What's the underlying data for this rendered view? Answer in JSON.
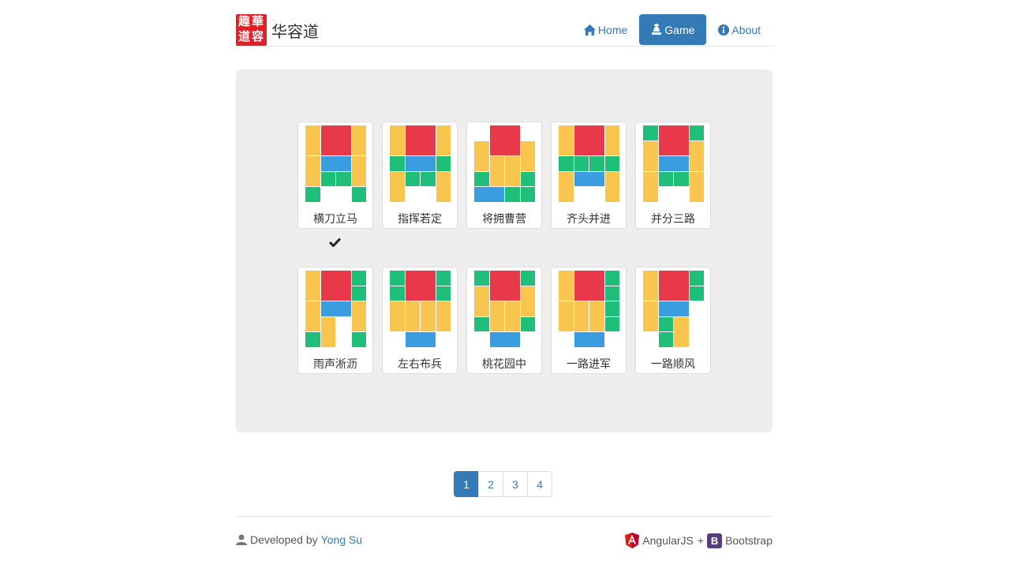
{
  "header": {
    "title": "华容道",
    "nav": [
      {
        "label": "Home",
        "icon": "home-icon",
        "active": false
      },
      {
        "label": "Game",
        "icon": "game-piece-icon",
        "active": true
      },
      {
        "label": "About",
        "icon": "info-icon",
        "active": false
      }
    ]
  },
  "colors": {
    "red": "#e8394a",
    "yellow": "#f8c64e",
    "green": "#1fbf7a",
    "blue": "#3a9de0",
    "accent": "#337ab7"
  },
  "levels": [
    {
      "label": "横刀立马",
      "solved": true,
      "pieces": [
        [
          0,
          0,
          1,
          2,
          "y"
        ],
        [
          1,
          0,
          2,
          2,
          "r"
        ],
        [
          3,
          0,
          1,
          2,
          "y"
        ],
        [
          0,
          2,
          1,
          2,
          "y"
        ],
        [
          1,
          2,
          2,
          1,
          "b"
        ],
        [
          3,
          2,
          1,
          2,
          "y"
        ],
        [
          1,
          3,
          1,
          1,
          "g"
        ],
        [
          2,
          3,
          1,
          1,
          "g"
        ],
        [
          0,
          4,
          1,
          1,
          "g"
        ],
        [
          3,
          4,
          1,
          1,
          "g"
        ]
      ]
    },
    {
      "label": "指挥若定",
      "solved": false,
      "pieces": [
        [
          0,
          0,
          1,
          2,
          "y"
        ],
        [
          1,
          0,
          2,
          2,
          "r"
        ],
        [
          3,
          0,
          1,
          2,
          "y"
        ],
        [
          0,
          2,
          1,
          1,
          "g"
        ],
        [
          1,
          2,
          2,
          1,
          "b"
        ],
        [
          3,
          2,
          1,
          1,
          "g"
        ],
        [
          0,
          3,
          1,
          2,
          "y"
        ],
        [
          1,
          3,
          1,
          1,
          "g"
        ],
        [
          2,
          3,
          1,
          1,
          "g"
        ],
        [
          3,
          3,
          1,
          2,
          "y"
        ]
      ]
    },
    {
      "label": "将拥曹营",
      "solved": false,
      "pieces": [
        [
          1,
          0,
          2,
          2,
          "r"
        ],
        [
          0,
          1,
          1,
          2,
          "y"
        ],
        [
          3,
          1,
          1,
          2,
          "y"
        ],
        [
          1,
          2,
          1,
          2,
          "y"
        ],
        [
          2,
          2,
          1,
          2,
          "y"
        ],
        [
          0,
          3,
          1,
          1,
          "g"
        ],
        [
          3,
          3,
          1,
          1,
          "g"
        ],
        [
          0,
          4,
          2,
          1,
          "b"
        ],
        [
          2,
          4,
          1,
          1,
          "g"
        ],
        [
          3,
          4,
          1,
          1,
          "g"
        ]
      ]
    },
    {
      "label": "齐头并进",
      "solved": false,
      "pieces": [
        [
          0,
          0,
          1,
          2,
          "y"
        ],
        [
          1,
          0,
          2,
          2,
          "r"
        ],
        [
          3,
          0,
          1,
          2,
          "y"
        ],
        [
          0,
          2,
          1,
          1,
          "g"
        ],
        [
          1,
          2,
          1,
          1,
          "g"
        ],
        [
          2,
          2,
          1,
          1,
          "g"
        ],
        [
          3,
          2,
          1,
          1,
          "g"
        ],
        [
          0,
          3,
          1,
          2,
          "y"
        ],
        [
          1,
          3,
          2,
          1,
          "b"
        ],
        [
          3,
          3,
          1,
          2,
          "y"
        ]
      ]
    },
    {
      "label": "并分三路",
      "solved": false,
      "pieces": [
        [
          0,
          0,
          1,
          1,
          "g"
        ],
        [
          1,
          0,
          2,
          2,
          "r"
        ],
        [
          3,
          0,
          1,
          1,
          "g"
        ],
        [
          0,
          1,
          1,
          2,
          "y"
        ],
        [
          3,
          1,
          1,
          2,
          "y"
        ],
        [
          1,
          2,
          2,
          1,
          "b"
        ],
        [
          0,
          3,
          1,
          2,
          "y"
        ],
        [
          1,
          3,
          1,
          1,
          "g"
        ],
        [
          2,
          3,
          1,
          1,
          "g"
        ],
        [
          3,
          3,
          1,
          2,
          "y"
        ]
      ]
    },
    {
      "label": "雨声淅沥",
      "solved": false,
      "pieces": [
        [
          0,
          0,
          1,
          2,
          "y"
        ],
        [
          1,
          0,
          2,
          2,
          "r"
        ],
        [
          3,
          0,
          1,
          1,
          "g"
        ],
        [
          3,
          1,
          1,
          1,
          "g"
        ],
        [
          0,
          2,
          1,
          2,
          "y"
        ],
        [
          1,
          2,
          2,
          1,
          "b"
        ],
        [
          3,
          2,
          1,
          2,
          "y"
        ],
        [
          1,
          3,
          1,
          2,
          "y"
        ],
        [
          0,
          4,
          1,
          1,
          "g"
        ],
        [
          3,
          4,
          1,
          1,
          "g"
        ]
      ]
    },
    {
      "label": "左右布兵",
      "solved": false,
      "pieces": [
        [
          0,
          0,
          1,
          1,
          "g"
        ],
        [
          1,
          0,
          2,
          2,
          "r"
        ],
        [
          3,
          0,
          1,
          1,
          "g"
        ],
        [
          0,
          1,
          1,
          1,
          "g"
        ],
        [
          3,
          1,
          1,
          1,
          "g"
        ],
        [
          0,
          2,
          1,
          2,
          "y"
        ],
        [
          1,
          2,
          1,
          2,
          "y"
        ],
        [
          2,
          2,
          1,
          2,
          "y"
        ],
        [
          3,
          2,
          1,
          2,
          "y"
        ],
        [
          1,
          4,
          2,
          1,
          "b"
        ]
      ]
    },
    {
      "label": "桃花园中",
      "solved": false,
      "pieces": [
        [
          0,
          0,
          1,
          1,
          "g"
        ],
        [
          1,
          0,
          2,
          2,
          "r"
        ],
        [
          3,
          0,
          1,
          1,
          "g"
        ],
        [
          0,
          1,
          1,
          2,
          "y"
        ],
        [
          3,
          1,
          1,
          2,
          "y"
        ],
        [
          1,
          2,
          1,
          2,
          "y"
        ],
        [
          2,
          2,
          1,
          2,
          "y"
        ],
        [
          0,
          3,
          1,
          1,
          "g"
        ],
        [
          3,
          3,
          1,
          1,
          "g"
        ],
        [
          1,
          4,
          2,
          1,
          "b"
        ]
      ]
    },
    {
      "label": "一路进军",
      "solved": false,
      "pieces": [
        [
          0,
          0,
          1,
          2,
          "y"
        ],
        [
          1,
          0,
          2,
          2,
          "r"
        ],
        [
          3,
          0,
          1,
          1,
          "g"
        ],
        [
          3,
          1,
          1,
          1,
          "g"
        ],
        [
          0,
          2,
          1,
          2,
          "y"
        ],
        [
          1,
          2,
          1,
          2,
          "y"
        ],
        [
          2,
          2,
          1,
          2,
          "y"
        ],
        [
          3,
          2,
          1,
          1,
          "g"
        ],
        [
          3,
          3,
          1,
          1,
          "g"
        ],
        [
          1,
          4,
          2,
          1,
          "b"
        ]
      ]
    },
    {
      "label": "一路顺风",
      "solved": false,
      "pieces": [
        [
          0,
          0,
          1,
          2,
          "y"
        ],
        [
          1,
          0,
          2,
          2,
          "r"
        ],
        [
          3,
          0,
          1,
          1,
          "g"
        ],
        [
          3,
          1,
          1,
          1,
          "g"
        ],
        [
          1,
          2,
          2,
          1,
          "b"
        ],
        [
          0,
          2,
          1,
          2,
          "y"
        ],
        [
          1,
          3,
          1,
          1,
          "g"
        ],
        [
          2,
          3,
          1,
          2,
          "y"
        ],
        [
          1,
          4,
          1,
          1,
          "g"
        ]
      ]
    }
  ],
  "pagination": {
    "pages": [
      "1",
      "2",
      "3",
      "4"
    ],
    "active": 0
  },
  "footer": {
    "developed_by": "Developed by",
    "author": "Yong Su",
    "tech_1": "AngularJS",
    "plus": "+",
    "tech_2_badge": "B",
    "tech_2": "Bootstrap"
  }
}
